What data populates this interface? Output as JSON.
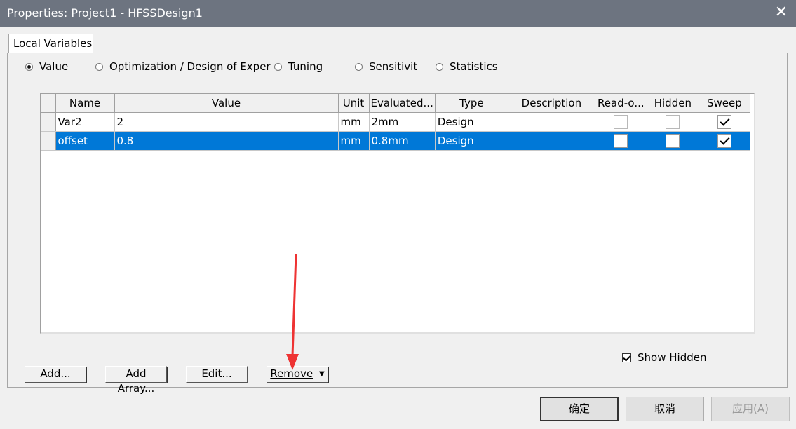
{
  "window": {
    "title": "Properties: Project1 - HFSSDesign1",
    "close_glyph": "✕"
  },
  "tab": {
    "label": "Local Variables"
  },
  "modes": [
    {
      "label": "Value",
      "selected": true
    },
    {
      "label": "Optimization / Design of Exper",
      "selected": false
    },
    {
      "label": "Tuning",
      "selected": false
    },
    {
      "label": "Sensitivity",
      "selected": false
    },
    {
      "label": "Statistics",
      "selected": false
    }
  ],
  "table": {
    "columns": [
      "Name",
      "Value",
      "Unit",
      "Evaluated...",
      "Type",
      "Description",
      "Read-o...",
      "Hidden",
      "Sweep"
    ],
    "rows": [
      {
        "name": "Var2",
        "value": "2",
        "unit": "mm",
        "evaluated": "2mm",
        "type": "Design",
        "description": "",
        "readonly": false,
        "hidden": false,
        "sweep": true,
        "selected": false
      },
      {
        "name": "offset",
        "value": "0.8",
        "unit": "mm",
        "evaluated": "0.8mm",
        "type": "Design",
        "description": "",
        "readonly": false,
        "hidden": false,
        "sweep": true,
        "selected": true
      }
    ]
  },
  "show_hidden": {
    "label": "Show Hidden",
    "checked": true
  },
  "buttons": {
    "add": "Add...",
    "add_array": "Add Array...",
    "edit": "Edit...",
    "remove": "Remove",
    "remove_arrow": "▼"
  },
  "footer": {
    "ok": "确定",
    "cancel": "取消",
    "apply": "应用(A)"
  },
  "annotation": {
    "arrow_color": "#ee3333"
  },
  "colors": {
    "titlebar": "#6d7480",
    "selection": "#0078d7"
  }
}
